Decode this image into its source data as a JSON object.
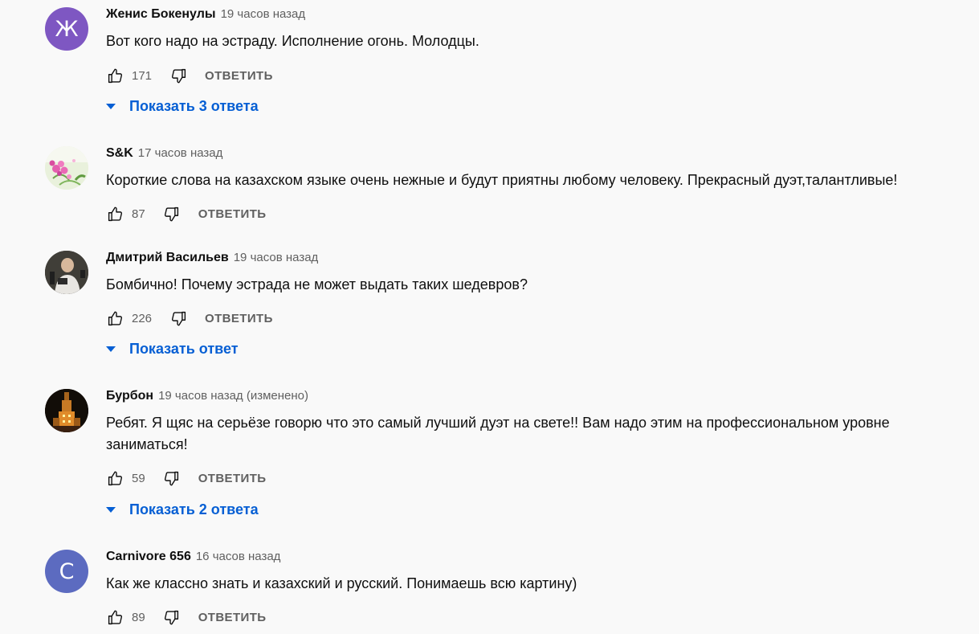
{
  "reply_label": "ОТВЕТИТЬ",
  "colors": {
    "link_blue": "#065fd4",
    "meta_gray": "#606060"
  },
  "comments": [
    {
      "author": "Женис Бокенулы",
      "time": "19 часов назад",
      "text": "Вот кого надо на эстраду. Исполнение огонь. Молодцы.",
      "likes": "171",
      "avatar": {
        "type": "letter",
        "letter": "Ж",
        "color": "#7e57c2"
      },
      "replies": "Показать 3 ответа"
    },
    {
      "author": "S&K",
      "time": "17 часов назад",
      "text": "Короткие слова на казахском языке очень нежные и будут приятны любому человеку. Прекрасный дуэт,талантливые!",
      "likes": "87",
      "avatar": {
        "type": "image",
        "description": "flowers-photo"
      }
    },
    {
      "author": "Дмитрий Васильев",
      "time": "19 часов назад",
      "text": "Бомбично! Почему эстрада не может выдать таких шедевров?",
      "likes": "226",
      "avatar": {
        "type": "image",
        "description": "man-photo"
      },
      "replies": "Показать ответ"
    },
    {
      "author": "Бурбон",
      "time": "19 часов назад (изменено)",
      "text": "Ребят. Я щяс на серьёзе говорю что это самый лучший дуэт на свете!! Вам надо этим на профессиональном уровне заниматься!",
      "likes": "59",
      "avatar": {
        "type": "image",
        "description": "night-tower-photo"
      },
      "replies": "Показать 2 ответа"
    },
    {
      "author": "Carnivore 656",
      "time": "16 часов назад",
      "text": "Как же классно знать и казахский и русский. Понимаешь всю картину)",
      "likes": "89",
      "avatar": {
        "type": "letter",
        "letter": "C",
        "color": "#5c6bc0"
      }
    }
  ]
}
